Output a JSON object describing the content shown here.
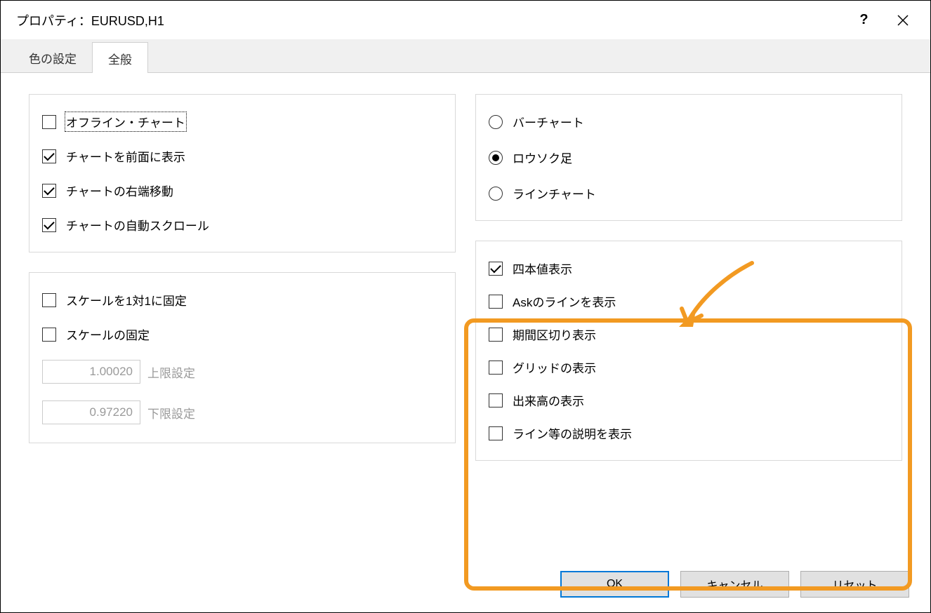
{
  "title": "プロパティ：EURUSD,H1",
  "tabs": {
    "t0": "色の設定",
    "t1": "全般"
  },
  "left1": {
    "c0": "オフライン・チャート",
    "c1": "チャートを前面に表示",
    "c2": "チャートの右端移動",
    "c3": "チャートの自動スクロール"
  },
  "left2": {
    "c0": "スケールを1対1に固定",
    "c1": "スケールの固定",
    "v0": "1.00020",
    "l0": "上限設定",
    "v1": "0.97220",
    "l1": "下限設定"
  },
  "chartType": {
    "r0": "バーチャート",
    "r1": "ロウソク足",
    "r2": "ラインチャート"
  },
  "rightChecks": {
    "c0": "四本値表示",
    "c1": "Askのラインを表示",
    "c2": "期間区切り表示",
    "c3": "グリッドの表示",
    "c4": "出来高の表示",
    "c5": "ライン等の説明を表示"
  },
  "buttons": {
    "ok": "OK",
    "cancel": "キャンセル",
    "reset": "リセット"
  }
}
